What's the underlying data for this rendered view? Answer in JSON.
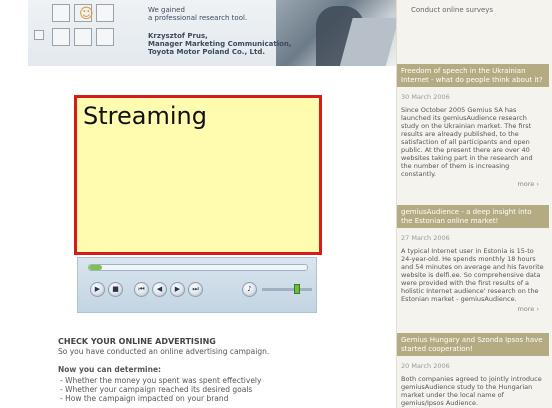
{
  "banner": {
    "line1": "We gained",
    "line2": "a professional research tool.",
    "author": "Krzysztof Prus,",
    "role": "Manager Marketing Communication,",
    "company": "Toyota Motor Poland Co., Ltd."
  },
  "player": {
    "title": "Streaming",
    "progress": 0.06,
    "volume": 0.7,
    "controls": [
      "play-icon",
      "stop-icon",
      "prev-icon",
      "rewind-icon",
      "forward-icon",
      "next-icon",
      "mute-icon"
    ]
  },
  "advertising": {
    "heading": "CHECK YOUR ONLINE ADVERTISING",
    "sub": "So you have conducted an online advertising campaign.",
    "determine": "Now you can determine:",
    "items": [
      "Whether the money you spent was spent effectively",
      "Whether your campaign reached its desired goals",
      "How the campaign impacted on your brand"
    ]
  },
  "sidebar": {
    "top_link": "Conduct online surveys",
    "news": [
      {
        "title": "Freedom of speech in the Ukrainian Internet - what do people think about it?",
        "date": "30 March 2006",
        "body": "Since October 2005 Gemius SA has launched its gemiusAudience research study on the Ukrainian market. The first results are already published, to the satisfaction of all participants and open public. At the present there are over 40 websites taking part in the research and the number of them is increasing constantly.",
        "more": "more"
      },
      {
        "title": "gemiusAudience - a deep insight into the Estonian online market!",
        "date": "27 March 2006",
        "body": "A typical Internet user in Estonia is 15-to 24-year-old. He spends monthly 18 hours and 54 minutes on average and his favorite website is delfi.ee. So comprehensive data were provided with the first results of a holistic Internet audience' research on the Estonian market - gemiusAudience.",
        "more": "more"
      },
      {
        "title": "Gemius Hungary and Szonda Ipsos have started cooperation!",
        "date": "20 March 2006",
        "body": "Both companies agreed to jointly introduce gemiusAudience study to the Hungarian market under the local name of gemius/Ipsos Audience.",
        "more": ""
      }
    ]
  }
}
